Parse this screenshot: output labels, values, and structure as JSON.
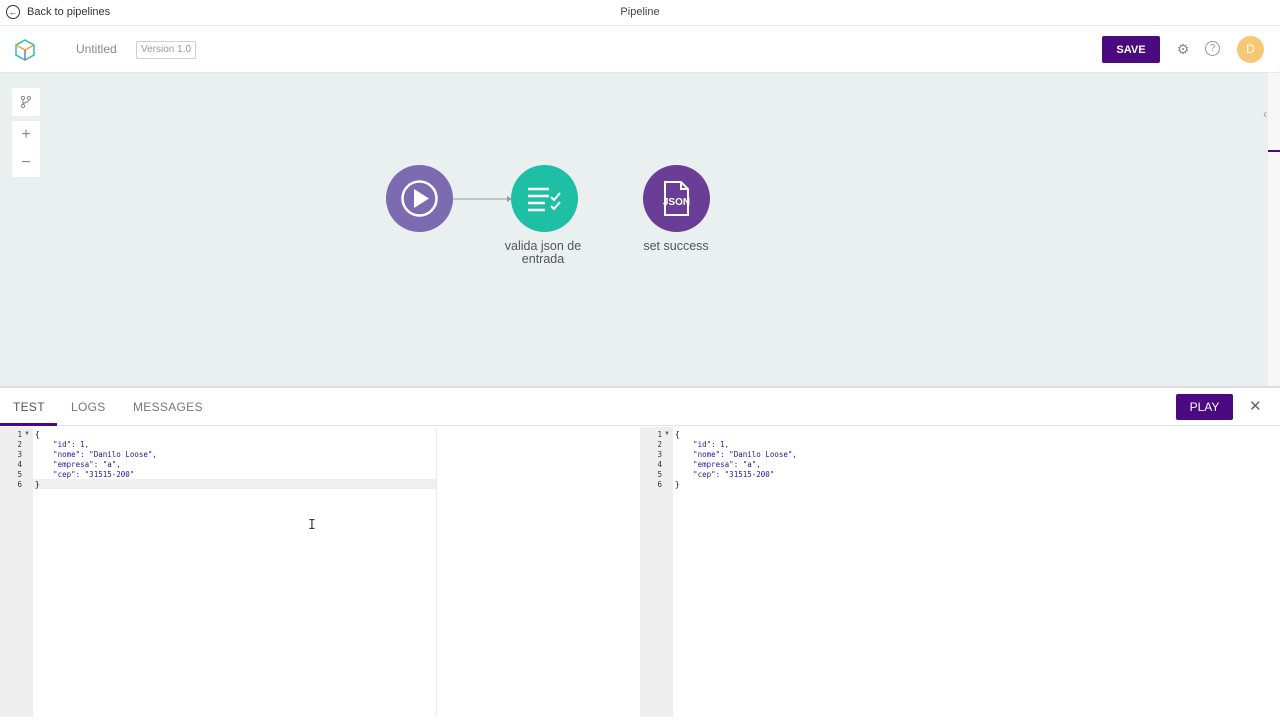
{
  "topbar": {
    "back_label": "Back to pipelines",
    "page_title": "Pipeline"
  },
  "header": {
    "pipeline_name": "Untitled",
    "version": "Version 1.0",
    "save_label": "SAVE",
    "avatar_initial": "D"
  },
  "canvas": {
    "nodes": [
      {
        "name": "trigger",
        "label": ""
      },
      {
        "name": "validator",
        "label_line1": "valida json de",
        "label_line2": "entrada"
      },
      {
        "name": "json",
        "label": "set success",
        "icon_text": "JSON"
      }
    ]
  },
  "bottom": {
    "tabs": [
      "TEST",
      "LOGS",
      "MESSAGES"
    ],
    "play_label": "PLAY",
    "input_lines": [
      "{",
      "    \"id\": 1,",
      "    \"nome\": \"Danilo Loose\",",
      "    \"empresa\": \"a\",",
      "    \"cep\": \"31515-200\"",
      "}"
    ],
    "output_lines": [
      "{",
      "    \"id\": 1,",
      "    \"nome\": \"Danilo Loose\",",
      "    \"empresa\": \"a\",",
      "    \"cep\": \"31515-200\"",
      "}"
    ],
    "line_numbers": [
      "1",
      "2",
      "3",
      "4",
      "5",
      "6"
    ]
  },
  "colors": {
    "accent": "#4b0a80",
    "trigger": "#7c6bb0",
    "validator": "#1fbfa6",
    "json": "#6a3d96",
    "canvas": "#eaf0f0"
  }
}
